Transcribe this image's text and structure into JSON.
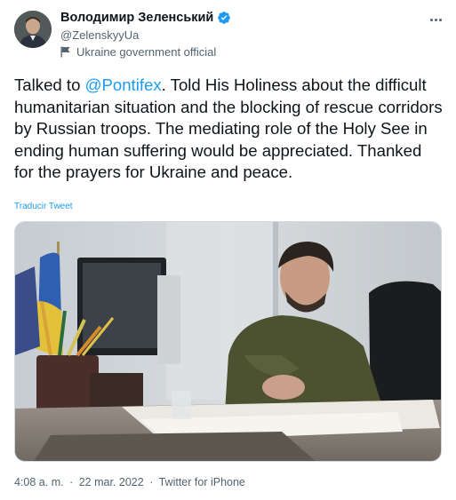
{
  "author": {
    "display_name": "Володимир Зеленський",
    "handle": "@ZelenskyyUa",
    "affiliation": "Ukraine government official"
  },
  "tweet": {
    "text_before": "Talked to ",
    "mention": "@Pontifex",
    "text_after": ". Told His Holiness about the difficult humanitarian situation and the blocking of rescue corridors by Russian troops. The mediating role of the Holy See in ending human suffering would be appreciated. Thanked for the prayers for Ukraine and peace.",
    "translate_label": "Traducir Tweet"
  },
  "meta": {
    "time": "4:08 a. m.",
    "date": "22 mar. 2022",
    "source": "Twitter for iPhone",
    "separator": "·"
  },
  "icons": {
    "verified": "verified-badge-icon",
    "affiliation": "flag-icon",
    "more": "more-options-icon"
  },
  "colors": {
    "accent": "#1d9bf0",
    "text": "#0f1419",
    "secondary": "#536471"
  }
}
